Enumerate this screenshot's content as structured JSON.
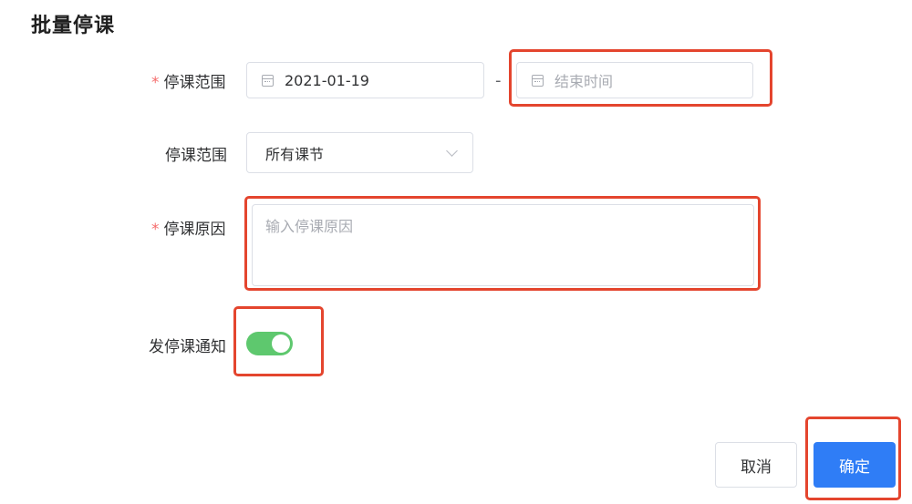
{
  "dialog": {
    "title": "批量停课"
  },
  "form": {
    "range_label": "停课范围",
    "start_date": "2021-01-19",
    "separator": "-",
    "end_date_placeholder": "结束时间",
    "scope_label": "停课范围",
    "scope_value": "所有课节",
    "reason_label": "停课原因",
    "reason_placeholder": "输入停课原因",
    "notify_label": "发停课通知",
    "notify_on": true,
    "required_mark": "*"
  },
  "footer": {
    "cancel_label": "取消",
    "confirm_label": "确定"
  },
  "colors": {
    "primary": "#2f7df6",
    "switch_on": "#5ec86e",
    "required": "#f56c6c",
    "highlight": "#e4452e"
  },
  "icons": [
    "calendar-icon",
    "chevron-down-icon"
  ]
}
